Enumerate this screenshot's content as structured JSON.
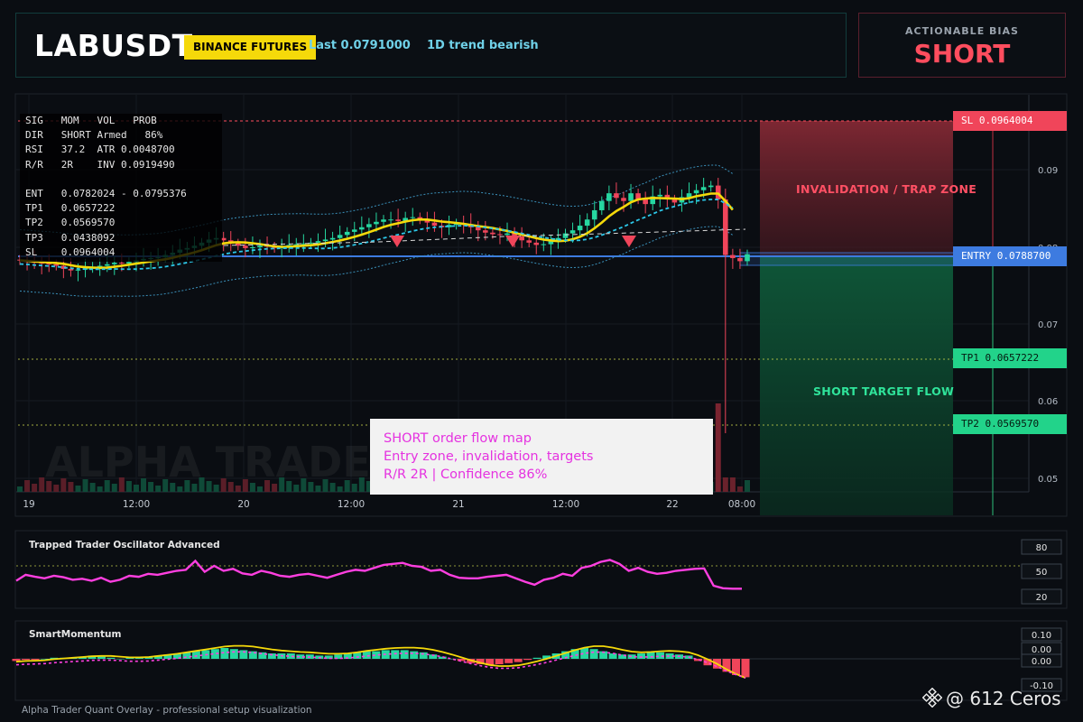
{
  "header": {
    "symbol": "LABUSDT",
    "exchange": "BINANCE FUTURES",
    "last": "Last 0.0791000",
    "trend": "1D trend bearish"
  },
  "bias": {
    "title": "ACTIONABLE BIAS",
    "value": "SHORT"
  },
  "info_table": [
    "SIG   MOM   VOL   PROB",
    "DIR   SHORT Armed   86%",
    "RSI   37.2  ATR 0.0048700",
    "R/R   2R    INV 0.0919490",
    "",
    "ENT   0.0782024 - 0.0795376",
    "TP1   0.0657222",
    "TP2   0.0569570",
    "TP3   0.0438092",
    "SL    0.0964004"
  ],
  "levels": {
    "sl": "SL 0.0964004",
    "entry": "ENTRY 0.0788700",
    "tp1": "TP1 0.0657222",
    "tp2": "TP2 0.0569570"
  },
  "zones": {
    "invalidation": "INVALIDATION / TRAP ZONE",
    "target": "SHORT TARGET FLOW"
  },
  "watermark": "ALPHA TRADER",
  "note": {
    "line1": "SHORT order flow map",
    "line2": "Entry zone, invalidation, targets",
    "line3": "R/R 2R | Confidence 86%"
  },
  "price_axis": [
    "0.09",
    "0.08",
    "0.07",
    "0.06",
    "0.05"
  ],
  "time_axis": [
    "19",
    "12:00",
    "20",
    "12:00",
    "21",
    "12:00",
    "22",
    "08:00"
  ],
  "oscillator": {
    "title": "Trapped Trader Oscillator Advanced",
    "levels": [
      "80",
      "50",
      "20"
    ]
  },
  "momentum": {
    "title": "SmartMomentum",
    "levels": [
      "0.10",
      "0.00",
      "0.00",
      "-0.10"
    ]
  },
  "footer": "Alpha Trader Quant Overlay - professional setup visualization",
  "credit": "@ 612 Ceros",
  "colors": {
    "bull": "#26d7a0",
    "bear": "#f0455a",
    "ma": "#f5d90a",
    "entry": "#3d7be0",
    "osc": "#ff3fe0",
    "accent_red": "#ff4d5e"
  },
  "icons": [
    "binance-logo-icon",
    "sell-signal-arrow-icon"
  ]
}
